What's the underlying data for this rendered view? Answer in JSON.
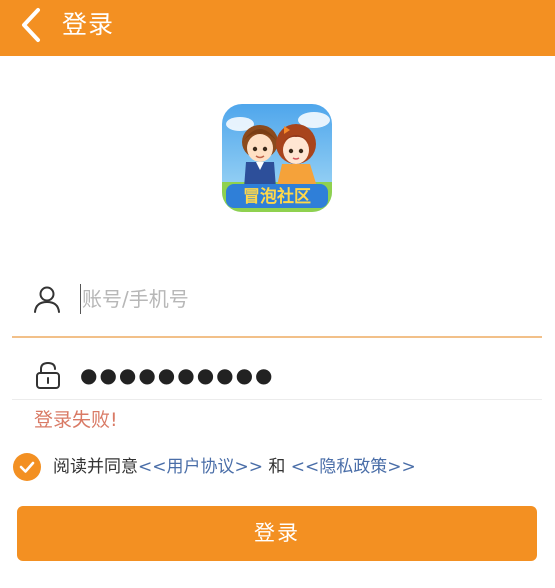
{
  "header": {
    "title": "登录",
    "back_icon": "chevron-left-icon",
    "background": "#f39022"
  },
  "logo": {
    "icon": "app-logo-icon",
    "text": "冒泡社区"
  },
  "account": {
    "icon": "user-icon",
    "placeholder": "账号/手机号",
    "value": ""
  },
  "password": {
    "icon": "lock-icon",
    "masked_value": "●●●●●●●●●●"
  },
  "error": {
    "message": "登录失败!",
    "color": "#d97a65"
  },
  "agreement": {
    "checked": true,
    "prefix": "阅读并同意",
    "user_agreement": "<<用户协议>>",
    "joiner": " 和 ",
    "privacy_policy": "<<隐私政策>>",
    "link_color": "#4a6ea8"
  },
  "login_button": {
    "label": "登录"
  }
}
